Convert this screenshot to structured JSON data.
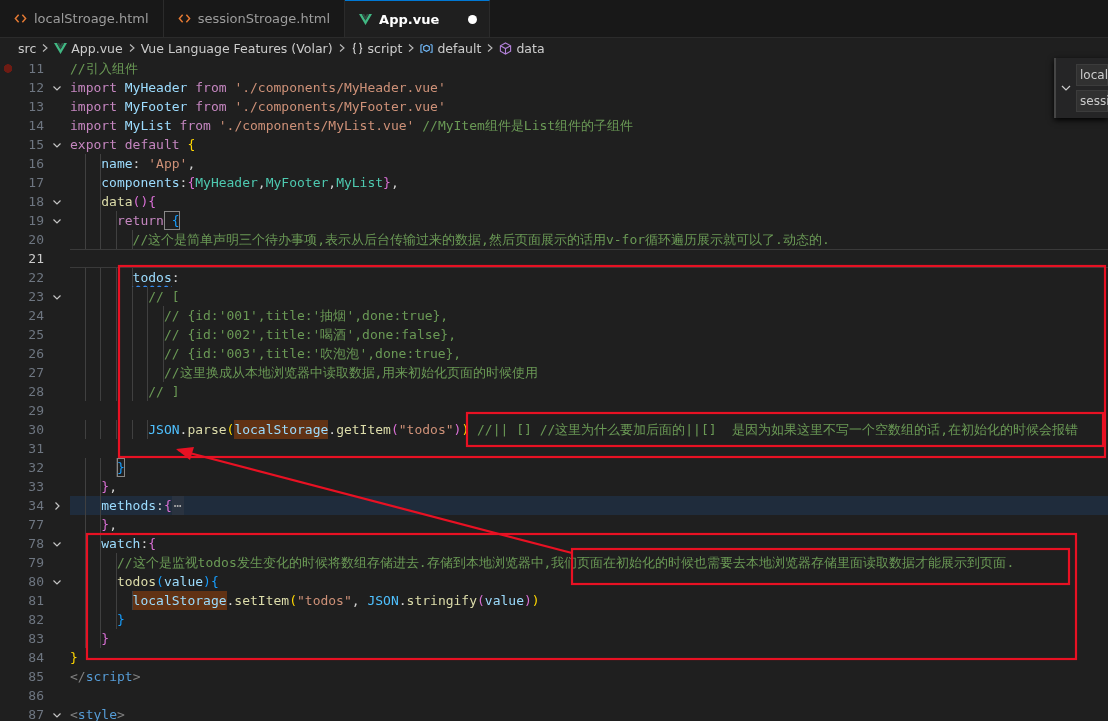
{
  "tabs": [
    {
      "label": "localStroage.html",
      "kind": "html",
      "selected": false,
      "dirty": false
    },
    {
      "label": "sessionStroage.html",
      "kind": "html",
      "selected": false,
      "dirty": false
    },
    {
      "label": "App.vue",
      "kind": "vue",
      "selected": true,
      "dirty": true
    }
  ],
  "breadcrumb": [
    {
      "label": "src",
      "kind": "folder"
    },
    {
      "label": "App.vue",
      "kind": "vue"
    },
    {
      "label": "Vue Language Features (Volar)",
      "kind": "extension"
    },
    {
      "label": "script",
      "kind": "braces"
    },
    {
      "label": "default",
      "kind": "module"
    },
    {
      "label": "data",
      "kind": "method"
    }
  ],
  "editor": {
    "lines": [
      {
        "number": "11",
        "kind": "plain",
        "current": false,
        "breakpoint": true,
        "tokens": [
          {
            "text": "//引入组件",
            "kind": "c"
          }
        ]
      },
      {
        "number": "12",
        "kind": "fold-open",
        "current": false,
        "breakpoint": false,
        "tokens": [
          {
            "text": "import",
            "kind": "k"
          },
          {
            "text": " MyHeader ",
            "kind": "v"
          },
          {
            "text": "from",
            "kind": "k"
          },
          {
            "text": " './components/MyHeader.vue'",
            "kind": "s"
          }
        ]
      },
      {
        "number": "13",
        "kind": "plain",
        "current": false,
        "breakpoint": false,
        "tokens": [
          {
            "text": "import",
            "kind": "k"
          },
          {
            "text": " MyFooter ",
            "kind": "v"
          },
          {
            "text": "from",
            "kind": "k"
          },
          {
            "text": " './components/MyFooter.vue'",
            "kind": "s"
          }
        ]
      },
      {
        "number": "14",
        "kind": "plain",
        "current": false,
        "breakpoint": false,
        "tokens": [
          {
            "text": "import",
            "kind": "k"
          },
          {
            "text": " MyList ",
            "kind": "v"
          },
          {
            "text": "from",
            "kind": "k"
          },
          {
            "text": " './components/MyList.vue'",
            "kind": "s"
          },
          {
            "text": " //MyItem组件是List组件的子组件",
            "kind": "c"
          }
        ]
      },
      {
        "number": "15",
        "kind": "fold-open",
        "current": false,
        "breakpoint": false,
        "tokens": [
          {
            "text": "export default",
            "kind": "k"
          },
          {
            "text": " {",
            "kind": "b1"
          }
        ]
      },
      {
        "number": "16",
        "kind": "plain",
        "current": false,
        "breakpoint": false,
        "tokens": [
          {
            "text": "    name",
            "kind": "v"
          },
          {
            "text": ":",
            "kind": "p"
          },
          {
            "text": " 'App'",
            "kind": "s"
          },
          {
            "text": ",",
            "kind": "p"
          }
        ]
      },
      {
        "number": "17",
        "kind": "plain",
        "current": false,
        "breakpoint": false,
        "tokens": [
          {
            "text": "    components",
            "kind": "v"
          },
          {
            "text": ":",
            "kind": "p"
          },
          {
            "text": "{",
            "kind": "b2"
          },
          {
            "text": "MyHeader",
            "kind": "t"
          },
          {
            "text": ",",
            "kind": "p"
          },
          {
            "text": "MyFooter",
            "kind": "t"
          },
          {
            "text": ",",
            "kind": "p"
          },
          {
            "text": "MyList",
            "kind": "t"
          },
          {
            "text": "}",
            "kind": "b2"
          },
          {
            "text": ",",
            "kind": "p"
          }
        ]
      },
      {
        "number": "18",
        "kind": "fold-open",
        "current": false,
        "breakpoint": false,
        "tokens": [
          {
            "text": "    data",
            "kind": "f"
          },
          {
            "text": "()",
            "kind": "b2"
          },
          {
            "text": "{",
            "kind": "b2"
          }
        ]
      },
      {
        "number": "19",
        "kind": "fold-open",
        "current": false,
        "breakpoint": false,
        "tokens": [
          {
            "text": "      return",
            "kind": "k"
          },
          {
            "text": " {",
            "kind": "b3m"
          }
        ]
      },
      {
        "number": "20",
        "kind": "plain",
        "current": false,
        "breakpoint": false,
        "tokens": [
          {
            "text": "        //这个是简单声明三个待办事项,表示从后台传输过来的数据,然后页面展示的话用v-for循环遍历展示就可以了.动态的.",
            "kind": "c"
          }
        ]
      },
      {
        "number": "21",
        "kind": "plain",
        "current": true,
        "breakpoint": false
      },
      {
        "number": "22",
        "kind": "plain",
        "current": false,
        "breakpoint": false,
        "tokens": [
          {
            "text": "        todos",
            "kind": "warn"
          },
          {
            "text": ":",
            "kind": "p"
          }
        ]
      },
      {
        "number": "23",
        "kind": "fold-open",
        "current": false,
        "breakpoint": false,
        "tokens": [
          {
            "text": "          // [",
            "kind": "c"
          }
        ]
      },
      {
        "number": "24",
        "kind": "plain",
        "current": false,
        "breakpoint": false,
        "tokens": [
          {
            "text": "            // {id:'001',title:'抽烟',done:true},",
            "kind": "c"
          }
        ]
      },
      {
        "number": "25",
        "kind": "plain",
        "current": false,
        "breakpoint": false,
        "tokens": [
          {
            "text": "            // {id:'002',title:'喝酒',done:false},",
            "kind": "c"
          }
        ]
      },
      {
        "number": "26",
        "kind": "plain",
        "current": false,
        "breakpoint": false,
        "tokens": [
          {
            "text": "            // {id:'003',title:'吹泡泡',done:true},",
            "kind": "c"
          }
        ]
      },
      {
        "number": "27",
        "kind": "plain",
        "current": false,
        "breakpoint": false,
        "tokens": [
          {
            "text": "            //这里换成从本地浏览器中读取数据,用来初始化页面的时候使用",
            "kind": "c"
          }
        ]
      },
      {
        "number": "28",
        "kind": "plain",
        "current": false,
        "breakpoint": false,
        "tokens": [
          {
            "text": "          // ]",
            "kind": "c"
          }
        ]
      },
      {
        "number": "29",
        "kind": "plain",
        "current": false,
        "breakpoint": false
      },
      {
        "number": "30",
        "kind": "plain",
        "current": false,
        "breakpoint": false,
        "tokens": [
          {
            "text": "          JSON",
            "kind": "g"
          },
          {
            "text": ".",
            "kind": "p"
          },
          {
            "text": "parse",
            "kind": "f"
          },
          {
            "text": "(",
            "kind": "b1"
          },
          {
            "text": "localStorage",
            "kind": "hl"
          },
          {
            "text": ".",
            "kind": "p"
          },
          {
            "text": "getItem",
            "kind": "f"
          },
          {
            "text": "(",
            "kind": "b2"
          },
          {
            "text": "\"todos\"",
            "kind": "s"
          },
          {
            "text": ")",
            "kind": "b2"
          },
          {
            "text": ")",
            "kind": "b1"
          },
          {
            "text": " //|| [] //这里为什么要加后面的||[]  是因为如果这里不写一个空数组的话,在初始化的时候会报错",
            "kind": "c"
          }
        ]
      },
      {
        "number": "31",
        "kind": "plain",
        "current": false,
        "breakpoint": false
      },
      {
        "number": "32",
        "kind": "plain",
        "current": false,
        "breakpoint": false,
        "tokens": [
          {
            "text": "      }",
            "kind": "b3m"
          }
        ]
      },
      {
        "number": "33",
        "kind": "plain",
        "current": false,
        "breakpoint": false,
        "tokens": [
          {
            "text": "    }",
            "kind": "b2"
          },
          {
            "text": ",",
            "kind": "p"
          }
        ]
      },
      {
        "number": "34",
        "kind": "folded",
        "current": false,
        "breakpoint": false,
        "tokens": [
          {
            "text": "    methods",
            "kind": "v"
          },
          {
            "text": ":",
            "kind": "p"
          },
          {
            "text": "{",
            "kind": "b2"
          },
          {
            "text": "⋯",
            "kind": "ellipsis"
          }
        ]
      },
      {
        "number": "77",
        "kind": "plain",
        "current": false,
        "breakpoint": false,
        "tokens": [
          {
            "text": "    }",
            "kind": "b2"
          },
          {
            "text": ",",
            "kind": "p"
          }
        ]
      },
      {
        "number": "78",
        "kind": "fold-open",
        "current": false,
        "breakpoint": false,
        "tokens": [
          {
            "text": "    watch",
            "kind": "v"
          },
          {
            "text": ":",
            "kind": "p"
          },
          {
            "text": "{",
            "kind": "b2"
          }
        ]
      },
      {
        "number": "79",
        "kind": "plain",
        "current": false,
        "breakpoint": false,
        "tokens": [
          {
            "text": "      //这个是监视todos发生变化的时候将数组存储进去.存储到本地浏览器中,我们页面在初始化的时候也需要去本地浏览器存储里面读取数据才能展示到页面.",
            "kind": "c"
          }
        ]
      },
      {
        "number": "80",
        "kind": "fold-open",
        "current": false,
        "breakpoint": false,
        "tokens": [
          {
            "text": "      todos",
            "kind": "f"
          },
          {
            "text": "(",
            "kind": "b3"
          },
          {
            "text": "value",
            "kind": "v"
          },
          {
            "text": ")",
            "kind": "b3"
          },
          {
            "text": "{",
            "kind": "b3"
          }
        ]
      },
      {
        "number": "81",
        "kind": "plain",
        "current": false,
        "breakpoint": false,
        "tokens": [
          {
            "text": "        localStorage",
            "kind": "hl"
          },
          {
            "text": ".",
            "kind": "p"
          },
          {
            "text": "setItem",
            "kind": "f"
          },
          {
            "text": "(",
            "kind": "b1"
          },
          {
            "text": "\"todos\"",
            "kind": "s"
          },
          {
            "text": ",",
            "kind": "p"
          },
          {
            "text": " JSON",
            "kind": "g"
          },
          {
            "text": ".",
            "kind": "p"
          },
          {
            "text": "stringify",
            "kind": "f"
          },
          {
            "text": "(",
            "kind": "b2"
          },
          {
            "text": "value",
            "kind": "v"
          },
          {
            "text": ")",
            "kind": "b2"
          },
          {
            "text": ")",
            "kind": "b1"
          }
        ]
      },
      {
        "number": "82",
        "kind": "plain",
        "current": false,
        "breakpoint": false,
        "tokens": [
          {
            "text": "      }",
            "kind": "b3"
          }
        ]
      },
      {
        "number": "83",
        "kind": "plain",
        "current": false,
        "breakpoint": false,
        "tokens": [
          {
            "text": "    }",
            "kind": "b2"
          }
        ]
      },
      {
        "number": "84",
        "kind": "plain",
        "current": false,
        "breakpoint": false,
        "tokens": [
          {
            "text": "}",
            "kind": "b1"
          }
        ]
      },
      {
        "number": "85",
        "kind": "plain",
        "current": false,
        "breakpoint": false,
        "tokens": [
          {
            "text": "</",
            "kind": "gray"
          },
          {
            "text": "script",
            "kind": "tag"
          },
          {
            "text": ">",
            "kind": "gray"
          }
        ]
      },
      {
        "number": "86",
        "kind": "plain",
        "current": false,
        "breakpoint": false
      },
      {
        "number": "87",
        "kind": "fold-open",
        "current": false,
        "breakpoint": false,
        "tokens": [
          {
            "text": "<",
            "kind": "gray"
          },
          {
            "text": "style",
            "kind": "tag"
          },
          {
            "text": ">",
            "kind": "gray"
          }
        ]
      }
    ]
  },
  "side_widget": {
    "items": [
      "local",
      "sessi"
    ]
  }
}
